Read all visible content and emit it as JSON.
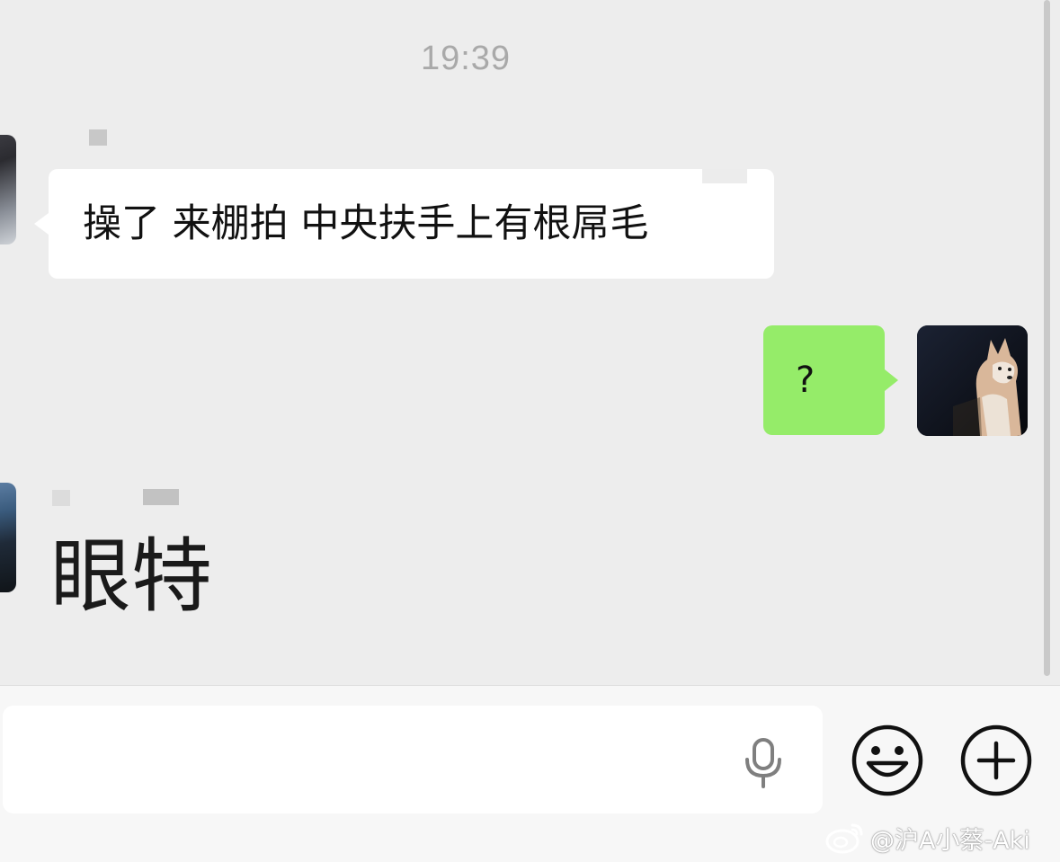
{
  "chat": {
    "timestamp": "19:39",
    "messages": [
      {
        "sender": "other",
        "text": "操了 来棚拍 中央扶手上有根屌毛"
      },
      {
        "sender": "me",
        "text": "?"
      },
      {
        "sender": "other",
        "text": "眼特"
      }
    ]
  },
  "input_bar": {
    "text_value": "",
    "voice_icon": "microphone-icon",
    "emoji_icon": "smiley-icon",
    "more_icon": "plus-circle-icon"
  },
  "watermark": {
    "icon": "weibo-logo",
    "text": "@沪A小蔡-Aki"
  },
  "colors": {
    "background": "#ededed",
    "incoming_bubble": "#ffffff",
    "outgoing_bubble": "#95ec69"
  }
}
